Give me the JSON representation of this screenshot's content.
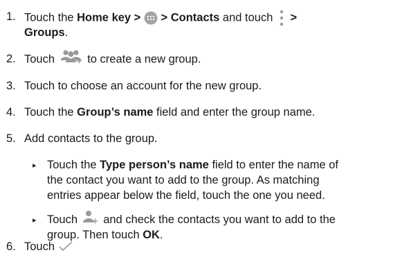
{
  "doc": {
    "steps": {
      "s1": {
        "n": "1.",
        "a": "Touch the ",
        "b1": "Home",
        "c": " key > ",
        "d": " > ",
        "b2": "Contacts",
        "e": " and touch ",
        "f": " >",
        "b3": "Groups",
        "g": "."
      },
      "s2": {
        "n": "2.",
        "a": "Touch ",
        "b": " to create a new group."
      },
      "s3": {
        "n": "3.",
        "text": "Touch to choose an account for the new group."
      },
      "s4": {
        "n": "4.",
        "a": "Touch the ",
        "b1": "Group’s name",
        "c": " field and enter the group name."
      },
      "s5": {
        "n": "5.",
        "text": "Add contacts to the group."
      },
      "s6": {
        "n": "6.",
        "a": "Touch "
      }
    },
    "sub": {
      "i1": {
        "l1a": "Touch the ",
        "l1b": "Type person’s name",
        "l1c": " field to enter the name of",
        "l2": "the contact you want to add to the group. As matching",
        "l3": "entries appear below the field, touch the one you need."
      },
      "i2": {
        "l1a": "Touch ",
        "l1b": " and check the contacts you want to add to the",
        "l2a": "group. Then touch ",
        "l2b": "OK",
        "l2c": "."
      }
    },
    "icons": [
      "apps-icon",
      "menu-dots-icon",
      "new-group-icon",
      "add-contact-icon",
      "checkmark-icon"
    ],
    "colors": {
      "text": "#1a1a1a",
      "icon_gray": "#9a9a9a"
    }
  }
}
